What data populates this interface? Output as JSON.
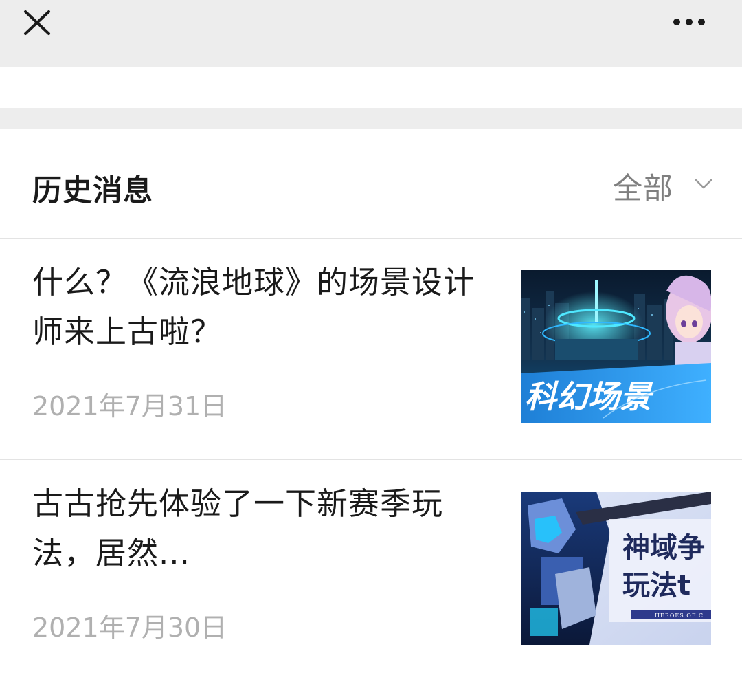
{
  "topbar": {
    "close_icon": "close-icon",
    "more_icon": "more-horizontal-icon"
  },
  "history": {
    "title": "历史消息",
    "filter_label": "全部",
    "filter_icon": "chevron-down-icon"
  },
  "articles": [
    {
      "title": "什么？《流浪地球》的场景设计师来上古啦？",
      "date": "2021年7月31日",
      "thumbnail_text": "科幻场景"
    },
    {
      "title": "古古抢先体验了一下新赛季玩法，居然...",
      "date": "2021年7月30日",
      "thumbnail_text": "神域争 玩法t"
    }
  ],
  "colors": {
    "topbar_bg": "#ededed",
    "title_text": "#1a1a1a",
    "secondary_text": "#7f7f7f",
    "date_text": "#b0b0b0"
  }
}
